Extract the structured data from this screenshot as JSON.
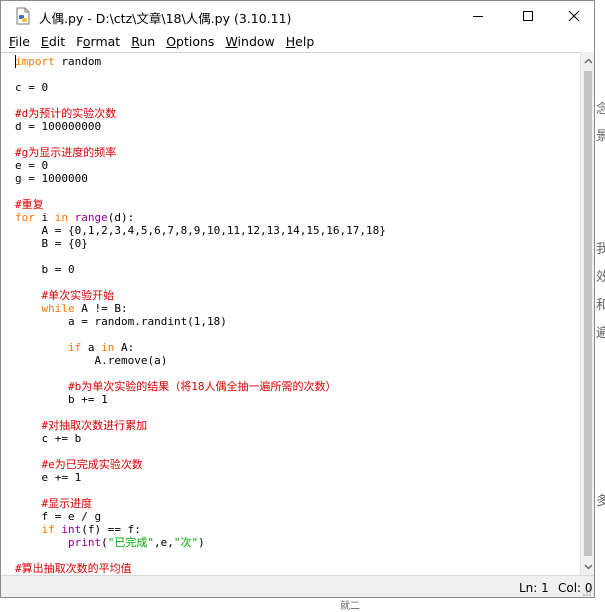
{
  "window": {
    "title": "人偶.py - D:\\ctz\\文章\\18\\人偶.py (3.10.11)",
    "icon": "python-file-icon"
  },
  "menu": [
    {
      "label": "File",
      "mnemonic": "F",
      "rest": "ile"
    },
    {
      "label": "Edit",
      "mnemonic": "E",
      "rest": "dit"
    },
    {
      "label": "Format",
      "mnemonic": "o",
      "pre": "F",
      "rest": "rmat"
    },
    {
      "label": "Run",
      "mnemonic": "R",
      "rest": "un"
    },
    {
      "label": "Options",
      "mnemonic": "O",
      "rest": "ptions"
    },
    {
      "label": "Window",
      "mnemonic": "W",
      "rest": "indow"
    },
    {
      "label": "Help",
      "mnemonic": "H",
      "rest": "elp"
    }
  ],
  "code_lines": [
    "import random",
    "",
    "c = 0",
    "",
    "#d为预计的实验次数",
    "d = 100000000",
    "",
    "#g为显示进度的频率",
    "e = 0",
    "g = 1000000",
    "",
    "#重复",
    "for i in range(d):",
    "    A = {0,1,2,3,4,5,6,7,8,9,10,11,12,13,14,15,16,17,18}",
    "    B = {0}",
    "",
    "    b = 0",
    "",
    "    #单次实验开始",
    "    while A != B:",
    "        a = random.randint(1,18)",
    "",
    "        if a in A:",
    "            A.remove(a)",
    "",
    "        #b为单次实验的结果（将18人偶全抽一遍所需的次数）",
    "        b += 1",
    "",
    "    #对抽取次数进行累加",
    "    c += b",
    "",
    "    #e为已完成实验次数",
    "    e += 1",
    "",
    "    #显示进度",
    "    f = e / g",
    "    if int(f) == f:",
    "        print(\"已完成\",e,\"次\")",
    "",
    "#算出抽取次数的平均值"
  ],
  "status": {
    "line": "Ln: 1",
    "col": "Col: 0"
  },
  "background_fragments": [
    "念",
    "景",
    "我",
    "效",
    "和",
    "遍",
    "多",
    "就二"
  ],
  "colors": {
    "keyword": "#ff7700",
    "builtin": "#900090",
    "comment": "#dd0000",
    "string": "#00aa00"
  }
}
